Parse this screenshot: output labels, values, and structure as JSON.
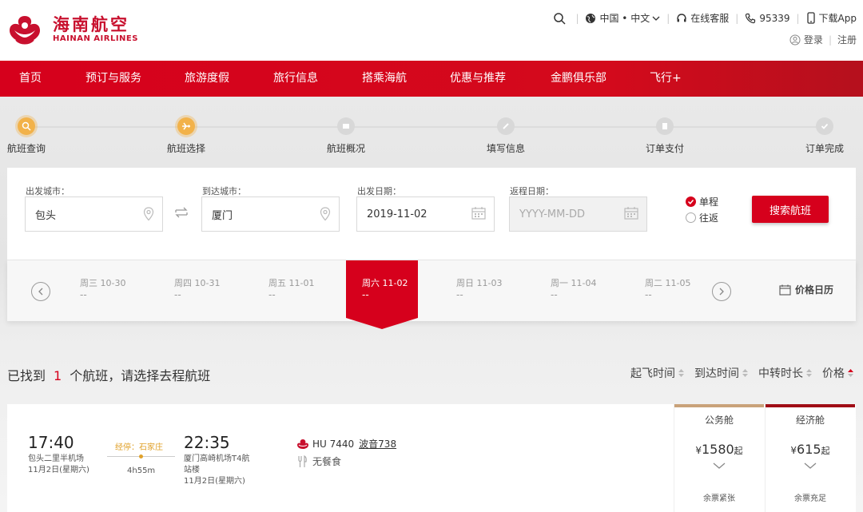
{
  "header": {
    "logo_cn": "海南航空",
    "logo_en": "HAINAN AIRLINES",
    "region": "中国 • 中文",
    "service": "在线客服",
    "phone": "95339",
    "download": "下载App",
    "login": "登录",
    "register": "注册"
  },
  "nav": [
    "首页",
    "预订与服务",
    "旅游度假",
    "旅行信息",
    "搭乘海航",
    "优惠与推荐",
    "金鹏俱乐部",
    "飞行+"
  ],
  "steps": [
    "航班查询",
    "航班选择",
    "航班概况",
    "填写信息",
    "订单支付",
    "订单完成"
  ],
  "search": {
    "from_label": "出发城市：",
    "from_value": "包头",
    "to_label": "到达城市：",
    "to_value": "厦门",
    "depart_label": "出发日期：",
    "depart_value": "2019-11-02",
    "return_label": "返程日期：",
    "return_placeholder": "YYYY-MM-DD",
    "one_way": "单程",
    "round_trip": "往返",
    "search_button": "搜索航班"
  },
  "dates": [
    {
      "label": "周三 10-30",
      "price": "--"
    },
    {
      "label": "周四 10-31",
      "price": "--"
    },
    {
      "label": "周五 11-01",
      "price": "--"
    },
    {
      "label": "周六 11-02",
      "price": "--"
    },
    {
      "label": "周日 11-03",
      "price": "--"
    },
    {
      "label": "周一 11-04",
      "price": "--"
    },
    {
      "label": "周二 11-05",
      "price": "--"
    }
  ],
  "price_calendar": "价格日历",
  "results": {
    "prefix": "已找到",
    "count": "1",
    "suffix": "个航班，请选择去程航班"
  },
  "sort": [
    "起飞时间",
    "到达时间",
    "中转时长",
    "价格"
  ],
  "flight": {
    "dep_time": "17:40",
    "dep_airport": "包头二里半机场",
    "dep_date": "11月2日(星期六)",
    "stop": "经停：石家庄",
    "duration": "4h55m",
    "arr_time": "22:35",
    "arr_airport_line1": "厦门高崎机场T4航",
    "arr_airport_line2": "站楼",
    "arr_date": "11月2日(星期六)",
    "flight_no": "HU 7440",
    "aircraft": "波音738",
    "meal": "无餐食",
    "fares": [
      {
        "class": "公务舱",
        "yen": "¥",
        "price": "1580",
        "qi": "起",
        "tickets": "余票紧张",
        "color": "#c9a27a"
      },
      {
        "class": "经济舱",
        "yen": "¥",
        "price": "615",
        "qi": "起",
        "tickets": "余票充足",
        "color": "#a00d16"
      }
    ]
  }
}
